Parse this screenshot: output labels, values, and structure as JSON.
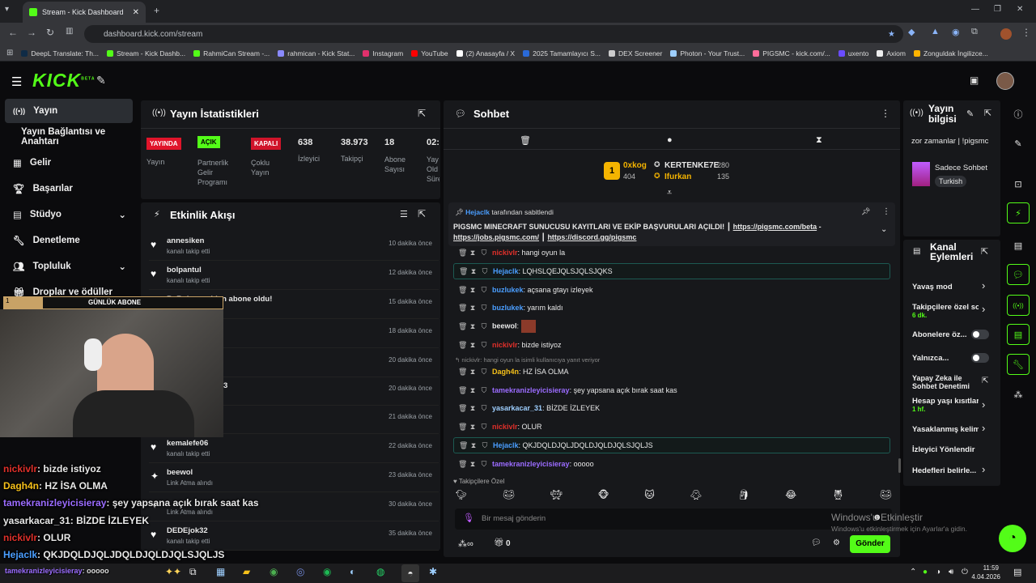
{
  "browser": {
    "tab_title": "Stream - Kick Dashboard",
    "url": "dashboard.kick.com/stream",
    "bookmarks": [
      {
        "label": "DeepL Translate: Th...",
        "color": "#0f2b46"
      },
      {
        "label": "Stream - Kick Dashb...",
        "color": "#53fc18"
      },
      {
        "label": "RahmiCan Stream -...",
        "color": "#53fc18"
      },
      {
        "label": "rahmican - Kick Stat...",
        "color": "#8a8aff"
      },
      {
        "label": "Instagram",
        "color": "#e1306c"
      },
      {
        "label": "YouTube",
        "color": "#ff0000"
      },
      {
        "label": "(2) Anasayfa / X",
        "color": "#ffffff"
      },
      {
        "label": "2025 Tamamlayıcı S...",
        "color": "#2a6ad8"
      },
      {
        "label": "DEX Screener",
        "color": "#cccccc"
      },
      {
        "label": "Photon - Your Trust...",
        "color": "#9ecfff"
      },
      {
        "label": "PIGSMC - kick.com/...",
        "color": "#ff6d9a"
      },
      {
        "label": "uxento",
        "color": "#6a4cff"
      },
      {
        "label": "Axiom",
        "color": "#eeeeee"
      },
      {
        "label": "Zonguldak İngilizce...",
        "color": "#ffb400"
      }
    ]
  },
  "header": {
    "logo": "KICK",
    "logo_beta": "BETA"
  },
  "sidebar": {
    "items": [
      {
        "label": "Yayın",
        "icon": "broadcast-icon"
      },
      {
        "label": "Yayın Bağlantısı ve Anahtarı",
        "icon": ""
      },
      {
        "label": "Gelir",
        "icon": "revenue-icon"
      },
      {
        "label": "Başarılar",
        "icon": "trophy-icon"
      },
      {
        "label": "Stüdyo",
        "icon": "studio-icon"
      },
      {
        "label": "Denetleme",
        "icon": "moderation-icon"
      },
      {
        "label": "Topluluk",
        "icon": "community-icon"
      },
      {
        "label": "Droplar ve ödüller",
        "icon": "gift-icon"
      }
    ]
  },
  "stats": {
    "title": "Yayın İstatistikleri",
    "cols": [
      {
        "badge": "YAYINDA",
        "label": "Yayın"
      },
      {
        "badge": "AÇIK",
        "label": "Partnerlik Gelir Programı"
      },
      {
        "badge": "KAPALI",
        "label": "Çoklu Yayın"
      },
      {
        "value": "638",
        "label": "İzleyici"
      },
      {
        "value": "38.973",
        "label": "Takipçi"
      },
      {
        "value": "18",
        "label": "Abone Sayısı"
      },
      {
        "value": "02:",
        "label": "Yay Old Süre"
      }
    ],
    "colors": {
      "live": "#e0142a",
      "on": "#53fc18",
      "off": "#d0142a"
    }
  },
  "activity": {
    "title": "Etkinlik Akışı",
    "items": [
      {
        "name": "annesiken",
        "sub": "kanalı takip etti",
        "time": "10 dakika önce"
      },
      {
        "name": "bolpantul",
        "sub": "kanalı takip etti",
        "time": "12 dakika önce"
      },
      {
        "name": "ByRuke yeniden abone oldu!",
        "sub": "",
        "time": "15 dakika önce"
      },
      {
        "name": "",
        "sub": "",
        "time": "18 dakika önce"
      },
      {
        "name": "",
        "sub": "",
        "time": "20 dakika önce"
      },
      {
        "name": "3",
        "sub": "",
        "time": "20 dakika önce"
      },
      {
        "name": "",
        "sub": "",
        "time": "21 dakika önce"
      },
      {
        "name": "kemalefe06",
        "sub": "kanalı takip etti",
        "time": "22 dakika önce"
      },
      {
        "name": "beewol",
        "sub": "Link Atma alındı",
        "time": "23 dakika önce"
      },
      {
        "name": "",
        "sub": "Link Atma alındı",
        "time": "30 dakika önce"
      },
      {
        "name": "DEDEjok32",
        "sub": "kanalı takip etti",
        "time": "35 dakika önce"
      }
    ]
  },
  "overlay": {
    "sub_bar_count": "1",
    "sub_bar_label": "GÜNLÜK ABONE",
    "chat": [
      {
        "user": "nickivlr",
        "text": ": bizde istiyoz",
        "color": "#e0302a"
      },
      {
        "user": "Dagh4n",
        "text": ": HZ İSA OLMA",
        "color": "#f5c01a"
      },
      {
        "user": "tamekranizleyicisieray",
        "text": ": şey yapsana açık bırak saat kas",
        "color": "#9b6cff"
      },
      {
        "user": "yasarkacar_31",
        "text": ": BİZDE İZLEYEK",
        "color": "#e8e8e8"
      },
      {
        "user": "nickivlr",
        "text": ": OLUR",
        "color": "#e0302a"
      },
      {
        "user": "Hejaclk",
        "text": ": QKJDQLDJQLJDQLDJQLDJQLSJQLJS",
        "color": "#4a9eff"
      },
      {
        "user": "tamekranizleyicisieray",
        "text": ": ooooo",
        "color": "#9b6cff"
      }
    ]
  },
  "chat": {
    "title": "Sohbet",
    "leaders": [
      {
        "rank": "1",
        "name": "0xkog",
        "value": "404"
      },
      {
        "name": "KERTENKE7E",
        "value": "280"
      },
      {
        "name": "Ifurkan",
        "value": "135"
      }
    ],
    "pinned_by": "Hejaclk",
    "pinned_by_suffix": "tarafından sabitlendi",
    "pinned_text": "PIGSMC MINECRAFT SUNUCUSU KAYITLARI VE EKİP BAŞVURULARI AÇILDI!",
    "pinned_links": [
      "https://pigsmc.com/beta",
      "https://jobs.pigsmc.com/",
      "https://discord.gg/pigsmc"
    ],
    "messages": [
      {
        "user": "nickivlr",
        "text": ": hangi oyun la",
        "color": "#e0302a"
      },
      {
        "user": "Hejaclk",
        "text": ": LQHSLQEJQLSJQLSJQKS",
        "color": "#4a9eff",
        "hl": true
      },
      {
        "user": "buzlukek",
        "text": ": açsana gtayı izleyek",
        "color": "#4a9eff"
      },
      {
        "user": "buzlukek",
        "text": ": yarım kaldı",
        "color": "#4a9eff"
      },
      {
        "user": "beewol",
        "text": ":",
        "color": "#e8e8e8"
      },
      {
        "user": "nickivlr",
        "text": ": bizde istiyoz",
        "color": "#e0302a"
      },
      {
        "user": "Dagh4n",
        "text": ": HZ İSA OLMA",
        "color": "#f5c01a"
      },
      {
        "user": "tamekranizleyicisieray",
        "text": ": şey yapsana açık bırak saat kas",
        "color": "#9b6cff"
      },
      {
        "user": "yasarkacar_31",
        "text": ": BİZDE İZLEYEK",
        "color": "#9ecfff"
      },
      {
        "user": "nickivlr",
        "text": ": OLUR",
        "color": "#e0302a"
      },
      {
        "user": "Hejaclk",
        "text": ": QKJDQLDJQLJDQLDJQLDJQLSJQLJS",
        "color": "#4a9eff",
        "hl": true
      },
      {
        "user": "tamekranizleyicisieray",
        "text": ": ooooo",
        "color": "#9b6cff"
      }
    ],
    "reply_hint": "nickivlr: hangi oyun la isimli kullanıcıya yanıt veriyor",
    "followers_only": "Takipçilere Özel",
    "input_placeholder": "Bir mesaj gönderin",
    "send_label": "Gönder",
    "bottom_count": "0"
  },
  "stream_info": {
    "title": "Yayın bilgisi",
    "stream_title": "zor zamanlar | !pigsmc",
    "category": "Sadece Sohbet",
    "tag": "Turkish"
  },
  "channel_actions": {
    "title": "Kanal Eylemleri",
    "items": [
      {
        "label": "Yavaş mod",
        "sub": ""
      },
      {
        "label": "Takipçilere özel so",
        "sub": "6 dk."
      },
      {
        "label": "Abonelere öz...",
        "sub": ""
      },
      {
        "label": "Yalnızca...",
        "sub": ""
      },
      {
        "label": "Yapay Zeka ile Sohbet Denetimi",
        "sub": ""
      },
      {
        "label": "Hesap yaşı kısıtlar",
        "sub": "1 hf."
      },
      {
        "label": "Yasaklanmış kelim",
        "sub": ""
      },
      {
        "label": "İzleyici Yönlendir",
        "sub": ""
      },
      {
        "label": "Hedefleri belirle...",
        "sub": ""
      }
    ]
  },
  "watermark": {
    "line1": "Windows'u Etkinleştir",
    "line2": "Windows'u etkinleştirmek için Ayarlar'a gidin."
  },
  "taskbar": {
    "time": "11:59",
    "date": "4.04.2026"
  }
}
